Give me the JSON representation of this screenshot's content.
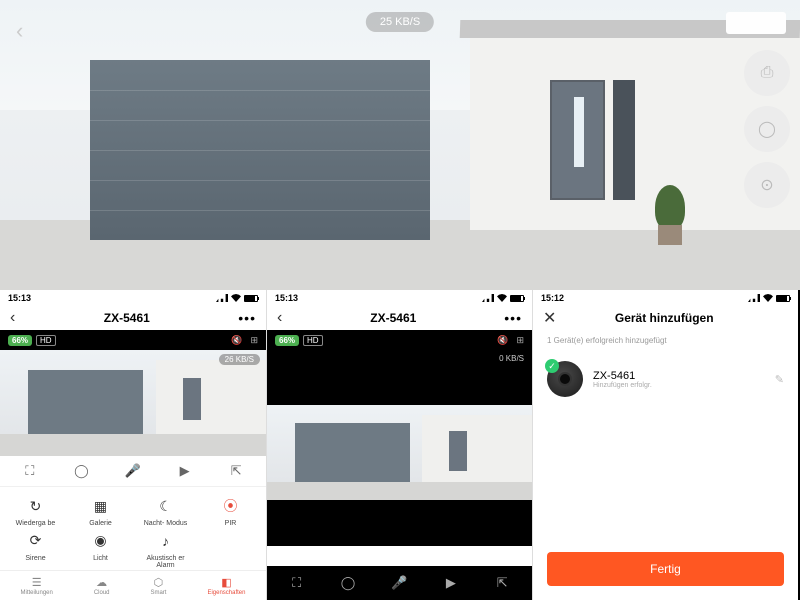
{
  "live": {
    "bitrate": "25 KB/S",
    "buttons": [
      "screenshot-icon",
      "mic-icon",
      "record-icon"
    ]
  },
  "phone1": {
    "time": "15:13",
    "title": "ZX-5461",
    "battery": "66%",
    "quality": "HD",
    "bitrate": "26 KB/S",
    "features": [
      {
        "icon": "↻",
        "label": "Wiederga\nbe"
      },
      {
        "icon": "▦",
        "label": "Galerie"
      },
      {
        "icon": "☾",
        "label": "Nacht-\nModus"
      },
      {
        "icon": "⦿",
        "label": "PIR",
        "red": true
      },
      {
        "icon": "⟳",
        "label": "Sirene"
      },
      {
        "icon": "◉",
        "label": "Licht"
      },
      {
        "icon": "♪",
        "label": "Akustisch\ner Alarm"
      }
    ],
    "tabs": [
      {
        "icon": "☰",
        "label": "Mitteilungen"
      },
      {
        "icon": "☁",
        "label": "Cloud"
      },
      {
        "icon": "⬡",
        "label": "Smart"
      },
      {
        "icon": "◧",
        "label": "Eigenschaften",
        "active": true
      }
    ]
  },
  "phone2": {
    "time": "15:13",
    "title": "ZX-5461",
    "battery": "66%",
    "quality": "HD",
    "bitrate": "0 KB/S"
  },
  "phone3": {
    "time": "15:12",
    "title": "Gerät hinzufügen",
    "subtitle": "1 Gerät(e) erfolgreich hinzugefügt",
    "device_name": "ZX-5461",
    "device_status": "Hinzufügen erfolgr.",
    "done": "Fertig"
  }
}
